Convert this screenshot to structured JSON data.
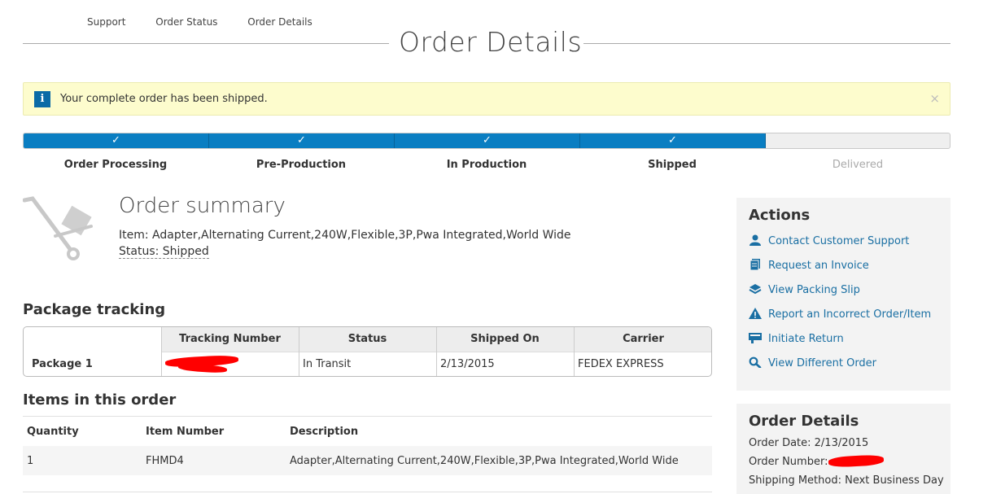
{
  "breadcrumb": {
    "items": [
      "Support",
      "Order Status",
      "Order Details"
    ]
  },
  "page": {
    "title": "Order Details"
  },
  "alert": {
    "text": "Your complete order has been shipped.",
    "icon": "info-icon",
    "close_glyph": "×"
  },
  "progress": {
    "steps": [
      "Order Processing",
      "Pre-Production",
      "In Production",
      "Shipped",
      "Delivered"
    ],
    "completed_count": 4,
    "check_glyph": "✓",
    "accent": "#0a7ec2"
  },
  "summary": {
    "title": "Order summary",
    "item": "Item: Adapter,Alternating Current,240W,Flexible,3P,Pwa Integrated,World Wide",
    "status": "Status: Shipped"
  },
  "package_tracking": {
    "heading": "Package tracking",
    "columns": [
      "Tracking Number",
      "Status",
      "Shipped On",
      "Carrier"
    ],
    "rows": [
      {
        "label": "Package 1",
        "tracking": "",
        "status": "In Transit",
        "shipped_on": "2/13/2015",
        "carrier": "FEDEX EXPRESS"
      }
    ]
  },
  "items": {
    "heading": "Items in this order",
    "columns": [
      "Quantity",
      "Item Number",
      "Description"
    ],
    "rows": [
      {
        "quantity": "1",
        "item_number": "FHMD4",
        "description": "Adapter,Alternating Current,240W,Flexible,3P,Pwa Integrated,World Wide"
      }
    ]
  },
  "actions": {
    "heading": "Actions",
    "items": [
      {
        "label": "Contact Customer Support",
        "icon": "person-icon"
      },
      {
        "label": "Request an Invoice",
        "icon": "document-icon"
      },
      {
        "label": "View Packing Slip",
        "icon": "layers-icon"
      },
      {
        "label": "Report an Incorrect Order/Item",
        "icon": "warning-icon"
      },
      {
        "label": "Initiate Return",
        "icon": "return-icon"
      },
      {
        "label": "View Different Order",
        "icon": "search-icon"
      }
    ]
  },
  "order_details": {
    "heading": "Order Details",
    "order_date": "Order Date: 2/13/2015",
    "order_number_label": "Order Number:",
    "shipping_method": "Shipping Method: Next Business Day"
  }
}
